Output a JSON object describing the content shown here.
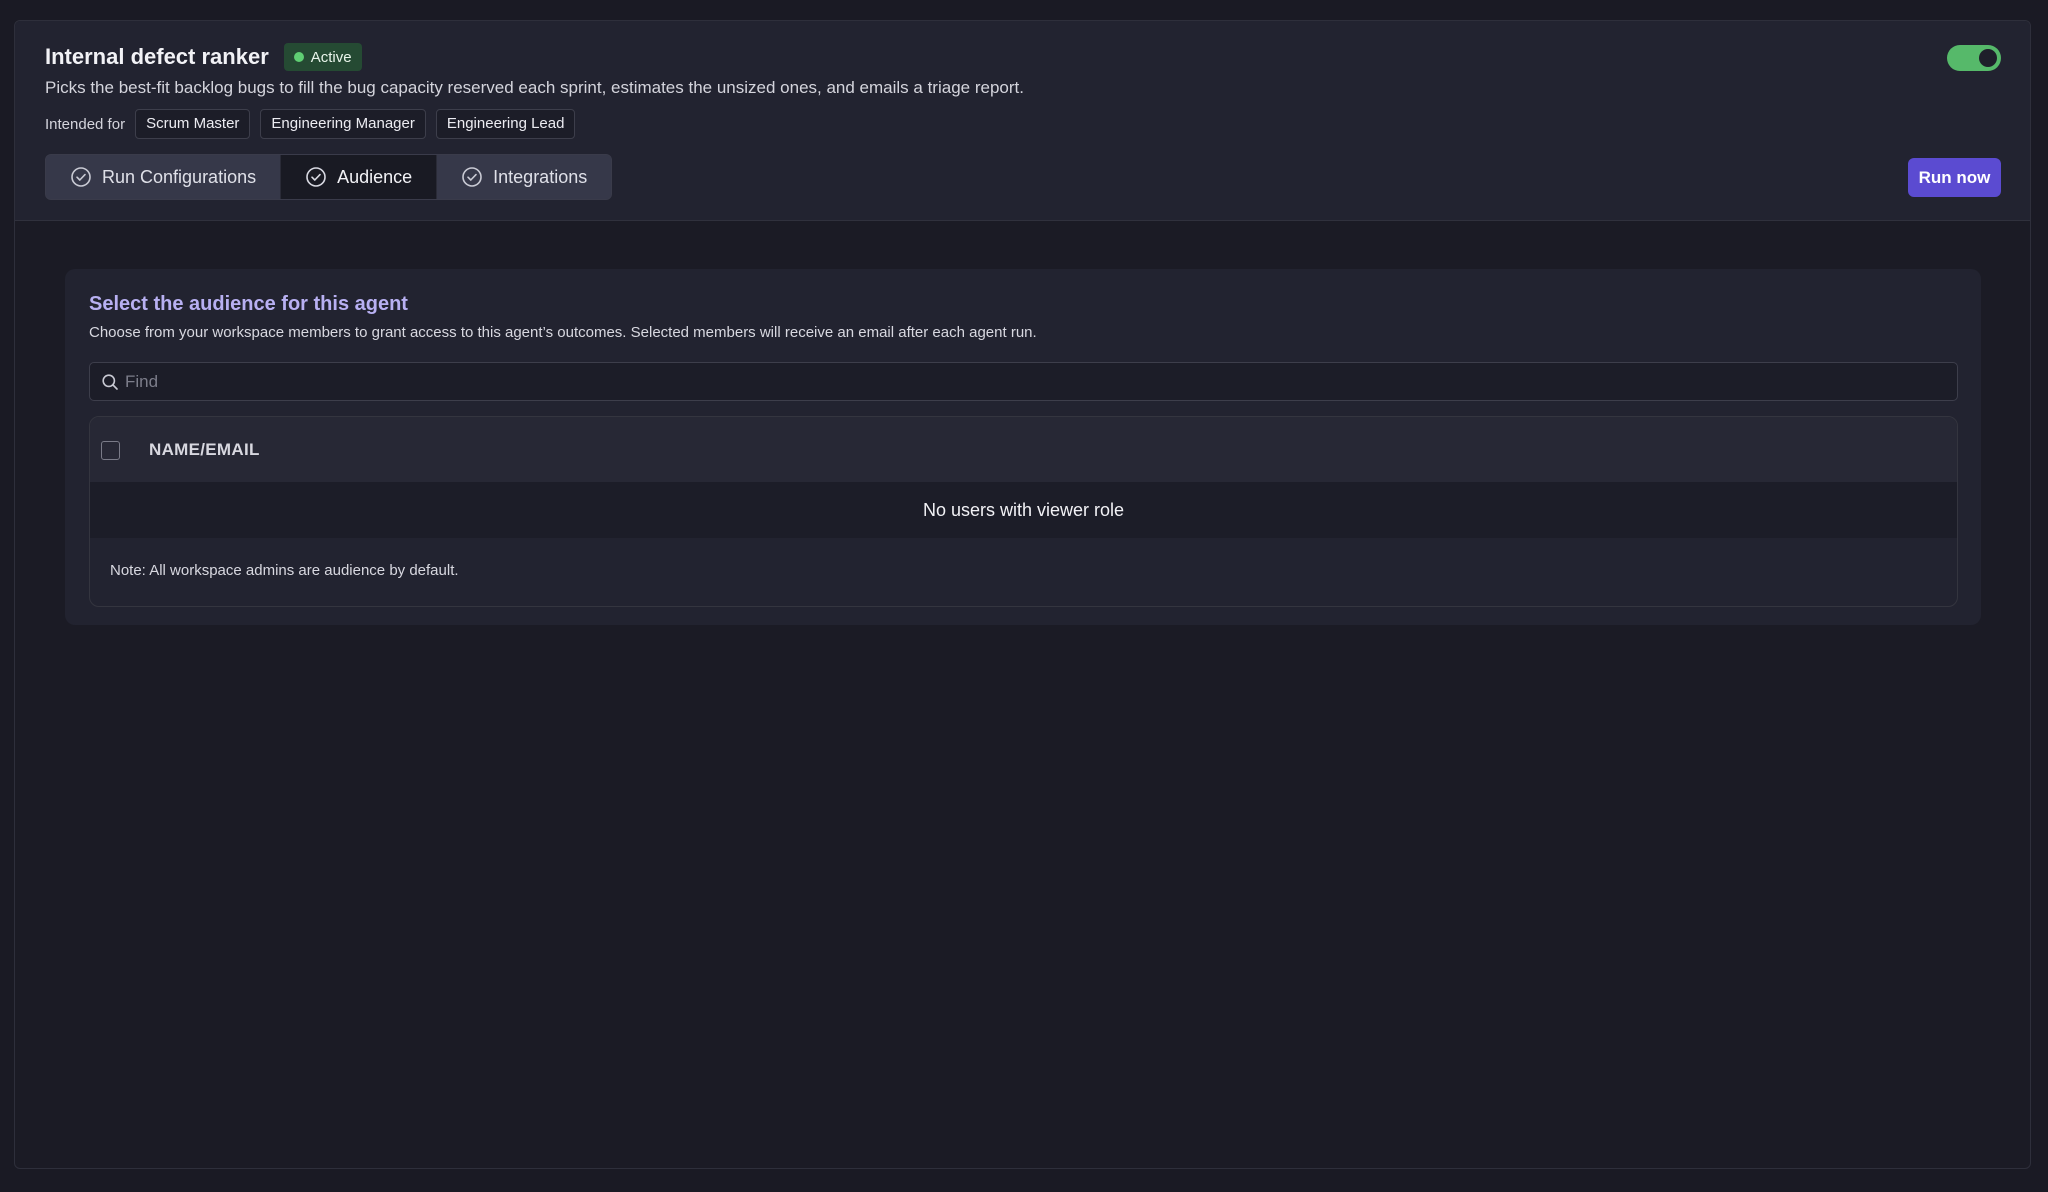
{
  "agent": {
    "title": "Internal defect ranker",
    "status": "Active",
    "enabled": true,
    "description": "Picks the best-fit backlog bugs to fill the bug capacity reserved each sprint, estimates the unsized ones, and emails a triage report.",
    "intended_label": "Intended for",
    "intended_for": [
      "Scrum Master",
      "Engineering Manager",
      "Engineering Lead"
    ]
  },
  "tabs": [
    {
      "label": "Run Configurations",
      "icon": "check-circle-icon",
      "active": false
    },
    {
      "label": "Audience",
      "icon": "check-circle-icon",
      "active": true
    },
    {
      "label": "Integrations",
      "icon": "check-circle-icon",
      "active": false
    }
  ],
  "actions": {
    "run_now": "Run now"
  },
  "audience": {
    "title": "Select the audience for this agent",
    "description": "Choose from your workspace members to grant access to this agent’s outcomes. Selected members will receive an email after each agent run.",
    "search_placeholder": "Find",
    "search_value": "",
    "column_header": "NAME/EMAIL",
    "empty_message": "No users with viewer role",
    "note": "Note: All workspace admins are audience by default."
  },
  "colors": {
    "accent": "#5b4bd1",
    "status_green": "#5fcf73",
    "heading_purple": "#b8b0f2"
  }
}
